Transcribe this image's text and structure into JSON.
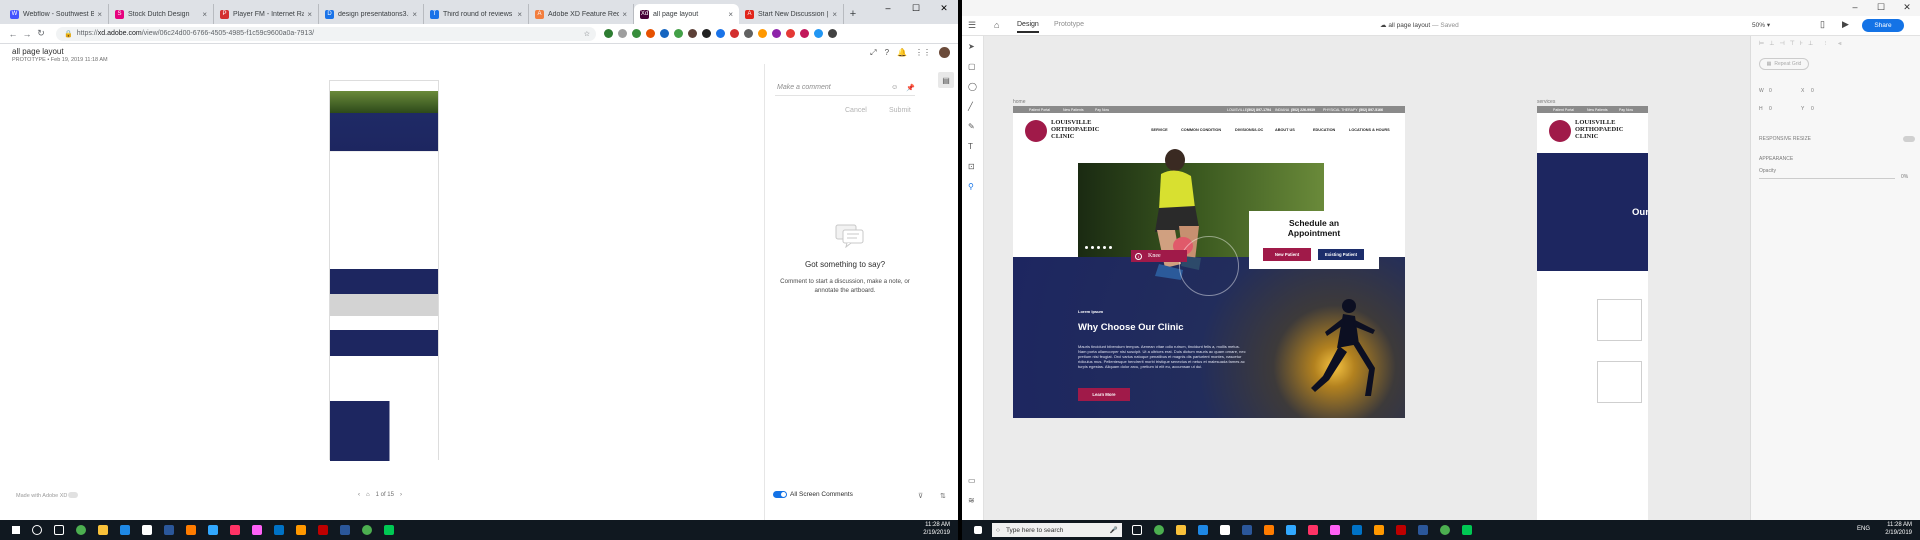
{
  "browser": {
    "tabs": [
      {
        "title": "Webflow - Southwest Blind",
        "fav_color": "#4353ff",
        "fav_glyph": "W"
      },
      {
        "title": "Stock Dutch Design",
        "fav_color": "#e6007e",
        "fav_glyph": "S"
      },
      {
        "title": "Player FM - Internet Ra",
        "fav_color": "#d32f2f",
        "fav_glyph": "P"
      },
      {
        "title": "design presentations3.pdf",
        "fav_color": "#1a73e8",
        "fav_glyph": "D"
      },
      {
        "title": "Third round of reviews - Dr",
        "fav_color": "#1a73e8",
        "fav_glyph": "T"
      },
      {
        "title": "Adobe XD Feature Reques",
        "fav_color": "#f27e3f",
        "fav_glyph": "A"
      },
      {
        "title": "all page layout",
        "fav_color": "#470137",
        "fav_glyph": "Xd",
        "active": true
      },
      {
        "title": "Start New Discussion | Ado",
        "fav_color": "#e1251b",
        "fav_glyph": "A"
      }
    ],
    "new_tab": "+",
    "window_controls": [
      "–",
      "☐",
      "✕"
    ],
    "url_scheme": "https://",
    "url_host": "xd.adobe.com",
    "url_path": "/view/06c24d00-6766-4505-4985-f1c59c9600a0a-7913/"
  },
  "xd_view": {
    "doc_title": "all page layout",
    "doc_meta": "PROTOTYPE  •  Feb 19, 2019 11:18 AM",
    "comment_placeholder": "Make a comment",
    "cancel": "Cancel",
    "submit": "Submit",
    "empty_title": "Got something to say?",
    "empty_hint": "Comment to start a discussion, make a note, or annotate the artboard.",
    "made_with": "Made with Adobe XD",
    "pager": "1 of 15",
    "all_screen_comments": "All Screen Comments"
  },
  "xd_app": {
    "tab_design": "Design",
    "tab_prototype": "Prototype",
    "doc_name": "all page layout",
    "saved": "Saved",
    "zoom": "50%",
    "share": "Share",
    "props": {
      "repeat_grid": "Repeat Grid",
      "w_label": "W",
      "w": "0",
      "x_label": "X",
      "x": "0",
      "h_label": "H",
      "h": "0",
      "y_label": "Y",
      "y": "0",
      "responsive": "RESPONSIVE RESIZE",
      "appearance": "APPEARANCE",
      "opacity_label": "Opacity",
      "opacity": "0%"
    }
  },
  "artboard": {
    "label": "home",
    "label2": "services",
    "top_links": [
      "Patient Portal",
      "New Patients",
      "Pay Now"
    ],
    "top_phones": [
      {
        "label": "LOUISVILLE",
        "num": "(502) 897-1794"
      },
      {
        "label": "INDIANA",
        "num": "(502) 226-9939"
      },
      {
        "label": "PHYSICAL THERAPY",
        "num": "(502) 897-5166"
      }
    ],
    "logo_line1": "LOUISVILLE",
    "logo_line2": "ORTHOPAEDIC",
    "logo_line3": "CLINIC",
    "nav": [
      "SERVICE",
      "COMMON CONDITION",
      "DIVISIONS/LOC",
      "ABOUT US",
      "EDUCATION",
      "LOCATIONS & HOURS"
    ],
    "appt_title_1": "Schedule an",
    "appt_title_2": "Appointment",
    "btn_new": "New Patient",
    "btn_existing": "Existing Patient",
    "knee": "Knee",
    "lorem": "Lorem Ipsum",
    "why_title": "Why Choose Our Clinic",
    "why_body": "Mauris tincidunt bibendum tempus. Aenean vitae odio rutrum, tincidunt felis a, mollis metus. Nam porta ullamcorper nisi suscipit. Ut a ultrices erat. Duis dictum mauris ac quam ornare, nec pretium nisi feugiat. Orci varius natoque penatibus et magnis dis parturient montes, nascetur ridiculus mus. Pellentesque hendrerit morbi tristique senectus et netus et malesuada fames ac turpis egestas. Aliquam dolor arcu, pretium id elit eu, accumsan ut dui.",
    "learn_more": "Learn More",
    "ab2_partial": "Our"
  },
  "taskbar": {
    "time_left": "11:28 AM",
    "date_left": "2/19/2019",
    "search_placeholder": "Type here to search",
    "time_right": "11:28 AM",
    "date_right": "2/19/2019",
    "lang": "ENG"
  },
  "colors": {
    "brand_crimson": "#a01a49",
    "brand_navy": "#1c2d6b",
    "xd_blue": "#1473e6"
  }
}
